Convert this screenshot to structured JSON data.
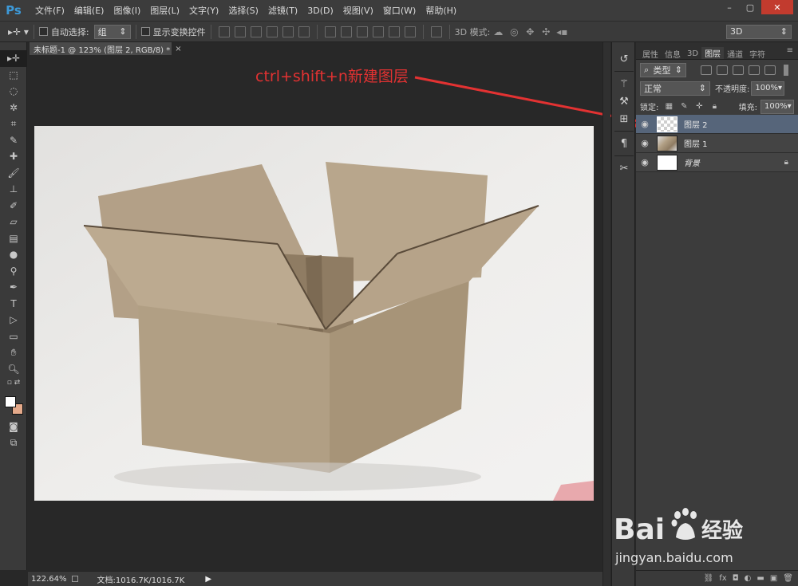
{
  "app": {
    "logo": "Ps",
    "menu": [
      "文件(F)",
      "编辑(E)",
      "图像(I)",
      "图层(L)",
      "文字(Y)",
      "选择(S)",
      "滤镜(T)",
      "3D(D)",
      "视图(V)",
      "窗口(W)",
      "帮助(H)"
    ],
    "window_controls": [
      "–",
      "▢",
      "✕"
    ]
  },
  "options": {
    "auto_select_label": "自动选择:",
    "auto_select_value": "组",
    "show_transform_label": "显示变换控件",
    "mode_label": "3D 模式:",
    "workspace_value": "3D"
  },
  "document": {
    "tab_title": "未标题-1 @ 123% (图层 2, RGB/8) *",
    "tab_close": "×",
    "zoom": "122.64%",
    "doc_info": "文档:1016.7K/1016.7K"
  },
  "annotation": {
    "text": "ctrl+shift+n新建图层",
    "color": "#e33232"
  },
  "panel": {
    "tabs": [
      "属性",
      "信息",
      "3D",
      "图层",
      "通道",
      "字符"
    ],
    "active_tab": "图层",
    "filter_value": "类型",
    "blend_mode": "正常",
    "opacity_label": "不透明度:",
    "opacity_value": "100%",
    "lock_label": "锁定:",
    "fill_label": "填充:",
    "fill_value": "100%",
    "layers": [
      {
        "name": "图层 2",
        "selected": true,
        "thumb": "transparent"
      },
      {
        "name": "图层 1",
        "selected": false,
        "thumb": "photo"
      },
      {
        "name": "背景",
        "selected": false,
        "thumb": "white",
        "locked": true
      }
    ]
  },
  "colors": {
    "foreground": "#ffffff",
    "background": "#e4a98a",
    "accent": "#3d9ad9",
    "selected_layer": "#56657a"
  },
  "watermark": {
    "brand": "Bai",
    "brand_cn": "经验",
    "url": "jingyan.baidu.com"
  }
}
